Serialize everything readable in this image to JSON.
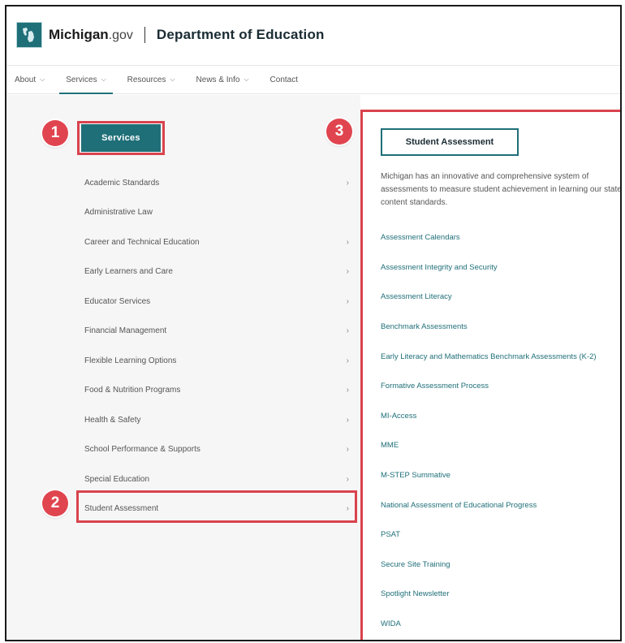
{
  "header": {
    "brand_main": "Michigan",
    "brand_suffix": ".gov",
    "separator": "|",
    "department": "Department of Education"
  },
  "nav": {
    "items": [
      {
        "label": "About",
        "has_dropdown": true
      },
      {
        "label": "Services",
        "has_dropdown": true,
        "active": true
      },
      {
        "label": "Resources",
        "has_dropdown": true
      },
      {
        "label": "News & Info",
        "has_dropdown": true
      },
      {
        "label": "Contact",
        "has_dropdown": false
      }
    ]
  },
  "left_menu": {
    "services_label": "Services",
    "items": [
      {
        "label": "Academic Standards",
        "has_arrow": true
      },
      {
        "label": "Administrative Law",
        "has_arrow": false
      },
      {
        "label": "Career and Technical Education",
        "has_arrow": true
      },
      {
        "label": "Early Learners and Care",
        "has_arrow": true
      },
      {
        "label": "Educator Services",
        "has_arrow": true
      },
      {
        "label": "Financial Management",
        "has_arrow": true
      },
      {
        "label": "Flexible Learning Options",
        "has_arrow": true
      },
      {
        "label": "Food & Nutrition Programs",
        "has_arrow": true
      },
      {
        "label": "Health & Safety",
        "has_arrow": true
      },
      {
        "label": "School Performance & Supports",
        "has_arrow": true
      },
      {
        "label": "Special Education",
        "has_arrow": true
      },
      {
        "label": "Student Assessment",
        "has_arrow": true
      }
    ]
  },
  "right_menu": {
    "title": "Student Assessment",
    "description": "Michigan has an innovative and comprehensive system of assessments to measure student achievement in learning our state content standards.",
    "items": [
      "Assessment Calendars",
      "Assessment Integrity and Security",
      "Assessment Literacy",
      "Benchmark Assessments",
      "Early Literacy and Mathematics Benchmark Assessments (K-2)",
      "Formative Assessment Process",
      "MI-Access",
      "MME",
      "M-STEP Summative",
      "National Assessment of Educational Progress",
      "PSAT",
      "Secure Site Training",
      "Spotlight Newsletter",
      "WIDA"
    ]
  },
  "annotations": {
    "badge_1": "1",
    "badge_2": "2",
    "badge_3": "3"
  },
  "colors": {
    "brand_teal": "#1f6f78",
    "highlight_red": "#d9434d",
    "badge_red": "#e0454f"
  },
  "icons": {
    "logo": "michigan-state-icon",
    "dropdown": "chevron-down-icon",
    "submenu": "chevron-right-icon"
  }
}
